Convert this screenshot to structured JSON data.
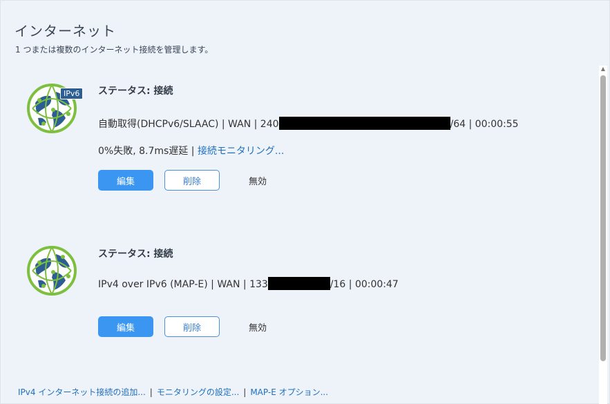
{
  "header": {
    "title": "インターネット",
    "subtitle": "1 つまたは複数のインターネット接続を管理します。"
  },
  "connections": [
    {
      "badge": "IPv6",
      "status": "ステータス: 接続",
      "detail_prefix": "自動取得(DHCPv6/SLAAC) | WAN | 240",
      "detail_suffix": "/64 | 00:00:55",
      "stats": "0%失敗, 8.7ms遅延 |",
      "monitor_link": "接続モニタリング...",
      "edit_label": "編集",
      "delete_label": "削除",
      "disable_label": "無効"
    },
    {
      "status": "ステータス: 接続",
      "detail_prefix": "IPv4 over IPv6 (MAP-E) | WAN | 133",
      "detail_suffix": "/16 | 00:00:47",
      "edit_label": "編集",
      "delete_label": "削除",
      "disable_label": "無効"
    }
  ],
  "footer": {
    "add_ipv4": "IPv4 インターネット接続の追加...",
    "separator": "|",
    "monitor_settings": "モニタリングの設定...",
    "mape_options": "MAP-E オプション..."
  },
  "colors": {
    "accent": "#3b96f2",
    "link": "#1f6fbf",
    "globe_green": "#7dbf3e",
    "globe_blue": "#2c5e93"
  }
}
